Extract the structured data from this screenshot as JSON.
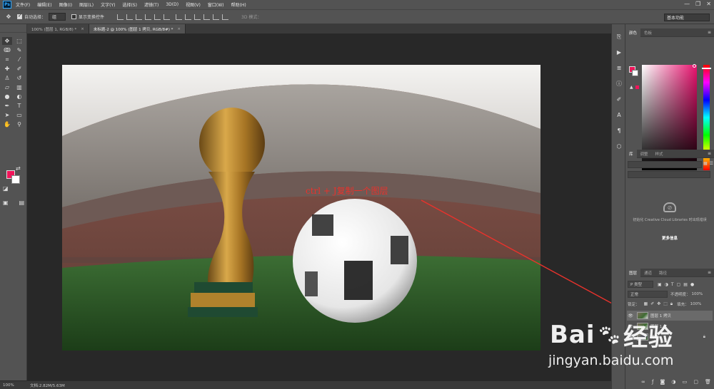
{
  "app": {
    "logo": "Ps"
  },
  "menu": [
    "文件(F)",
    "编辑(E)",
    "图像(I)",
    "图层(L)",
    "文字(Y)",
    "选择(S)",
    "滤镜(T)",
    "3D(D)",
    "视图(V)",
    "窗口(W)",
    "帮助(H)"
  ],
  "window_controls": {
    "minimize": "—",
    "restore": "❐",
    "close": "✕"
  },
  "options": {
    "auto_select_label": "自动选择：",
    "auto_select_value": "组",
    "show_transform_label": "显示变换控件",
    "mode_3d_label": "3D 模式：",
    "workspace": "基本功能"
  },
  "tabs": [
    {
      "label": "100% (图层 1, RGB/8) *",
      "close": "×"
    },
    {
      "label": "未标题-2 @ 100% (图层 1 拷贝, RGB/8#) *",
      "close": "×"
    }
  ],
  "status": {
    "zoom": "100%",
    "doc": "文档:2.82M/5.63M"
  },
  "color_panel": {
    "tabs": [
      "颜色",
      "色板"
    ],
    "fg": "#f0145a",
    "bg": "#ffffff",
    "hue": "#e8126e"
  },
  "libraries_panel": {
    "tabs": [
      "库",
      "调整",
      "样式"
    ],
    "message": "初始化 Creative Cloud Libraries 时出现错误",
    "more_info": "更多信息"
  },
  "layers_panel": {
    "tabs": [
      "图层",
      "通道",
      "路径"
    ],
    "filter": "P 类型",
    "blend_mode": "正常",
    "opacity_label": "不透明度：",
    "opacity": "100%",
    "lock_label": "锁定：",
    "fill_label": "填充：",
    "fill": "100%",
    "layers": [
      {
        "name": "图层 1 拷贝",
        "selected": true,
        "visible": true
      },
      {
        "name": "图层 1",
        "selected": false,
        "visible": true
      },
      {
        "name": "背景",
        "selected": false,
        "visible": true,
        "locked": true
      }
    ]
  },
  "annotation": {
    "text": "ctrl + J复制一个图层",
    "color": "#e8322c"
  },
  "watermark": {
    "brand_left": "Bai",
    "brand_right": "经验",
    "url": "jingyan.baidu.com"
  }
}
